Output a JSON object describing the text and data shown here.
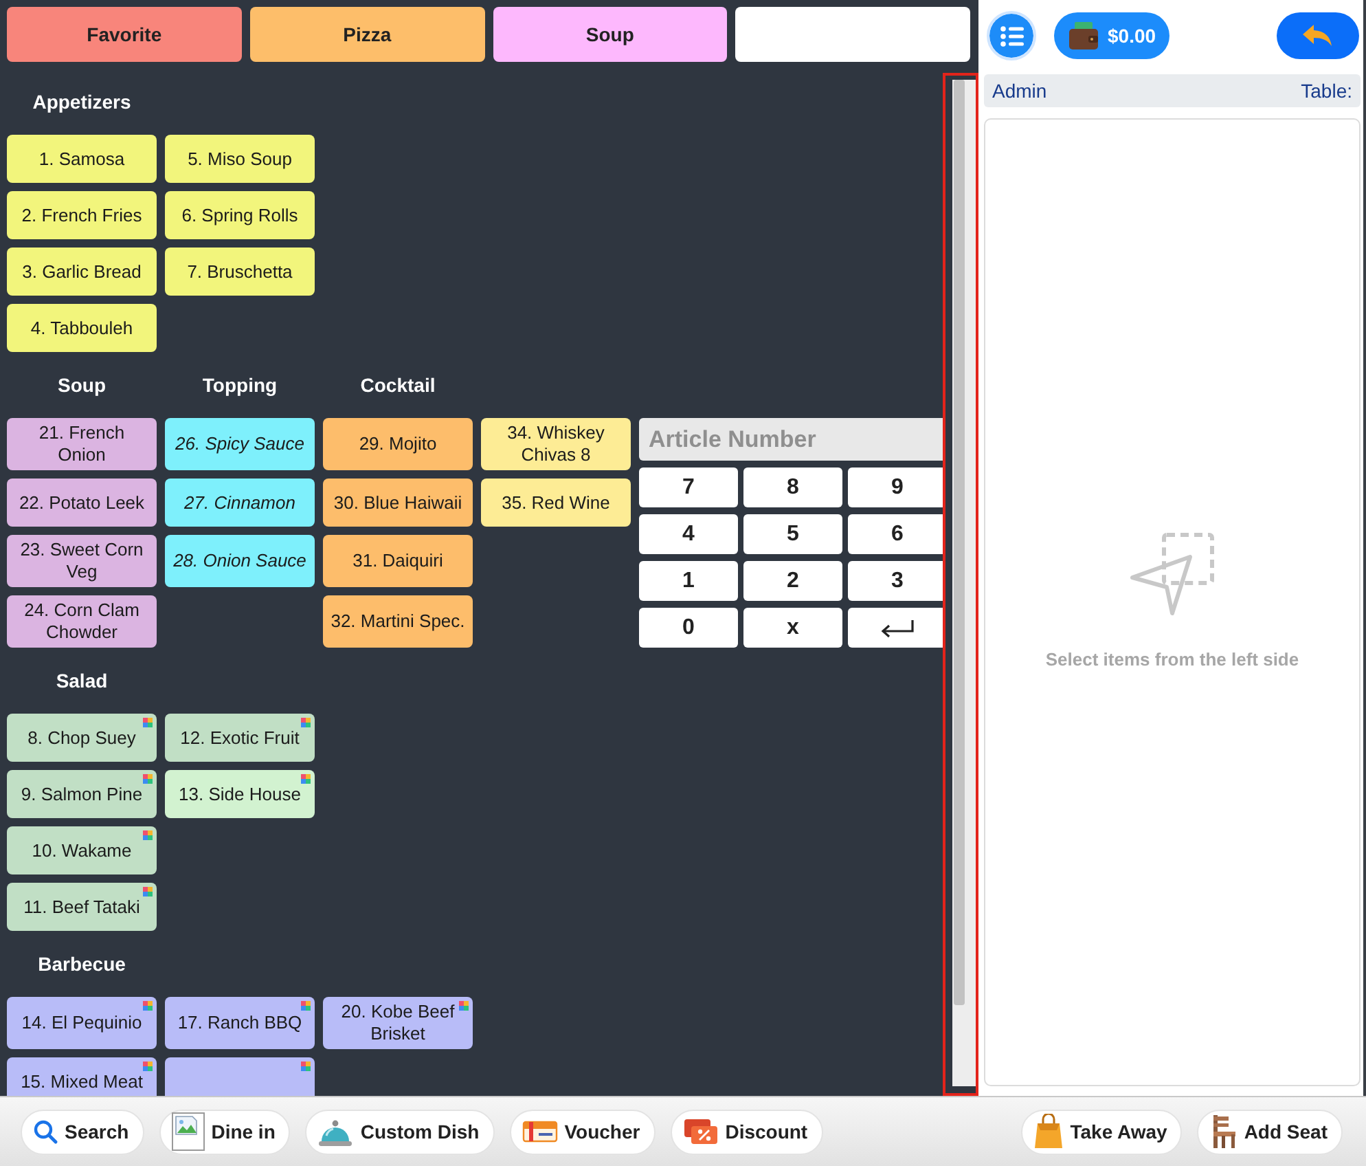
{
  "category_tabs": [
    {
      "label": "Favorite",
      "color": "#f8857b"
    },
    {
      "label": "Pizza",
      "color": "#fdbe6a"
    },
    {
      "label": "Soup",
      "color": "#fdb8fd"
    },
    {
      "color": "#ffffff"
    }
  ],
  "menu": {
    "rows": [
      {
        "sections": [
          {
            "title": "Appetizers",
            "italic": false,
            "columns": [
              [
                {
                  "label": "1. Samosa",
                  "color": "#f2f57c",
                  "badge": false
                },
                {
                  "label": "2. French Fries",
                  "color": "#f2f57c",
                  "badge": false
                },
                {
                  "label": "3. Garlic Bread",
                  "color": "#f2f57c",
                  "badge": false
                },
                {
                  "label": "4. Tabbouleh",
                  "color": "#f2f57c",
                  "badge": false
                }
              ],
              [
                {
                  "label": "5. Miso Soup",
                  "color": "#f2f57c",
                  "badge": false
                },
                {
                  "label": "6. Spring Rolls",
                  "color": "#f2f57c",
                  "badge": false
                },
                {
                  "label": "7. Bruschetta",
                  "color": "#f2f57c",
                  "badge": false
                }
              ]
            ]
          }
        ]
      },
      {
        "sections": [
          {
            "title": "Soup",
            "italic": false,
            "columns": [
              [
                {
                  "label": "21. French Onion",
                  "color": "#dbb4e1",
                  "badge": false
                },
                {
                  "label": "22. Potato Leek",
                  "color": "#dbb4e1",
                  "badge": false
                },
                {
                  "label": "23. Sweet Corn Veg",
                  "color": "#dbb4e1",
                  "badge": false
                },
                {
                  "label": "24. Corn Clam Chowder",
                  "color": "#dbb4e1",
                  "badge": false
                }
              ]
            ]
          },
          {
            "title": "Topping",
            "italic": true,
            "columns": [
              [
                {
                  "label": "26. Spicy Sauce",
                  "color": "#7ef0fc",
                  "badge": false
                },
                {
                  "label": "27. Cinnamon",
                  "color": "#7ef0fc",
                  "badge": false
                },
                {
                  "label": "28. Onion Sauce",
                  "color": "#7ef0fc",
                  "badge": false
                }
              ]
            ]
          },
          {
            "title": "Cocktail",
            "italic": false,
            "columns": [
              [
                {
                  "label": "29. Mojito",
                  "color": "#fdbd6b",
                  "badge": false
                },
                {
                  "label": "30. Blue Haiwaii",
                  "color": "#fdbd6b",
                  "badge": false
                },
                {
                  "label": "31. Daiquiri",
                  "color": "#fdbd6b",
                  "badge": false
                },
                {
                  "label": "32. Martini Spec.",
                  "color": "#fdbd6b",
                  "badge": false
                }
              ],
              [
                {
                  "label": "34. Whiskey Chivas 8",
                  "color": "#fdec95",
                  "badge": false
                },
                {
                  "label": "35. Red Wine",
                  "color": "#fdec95",
                  "badge": false
                }
              ]
            ]
          }
        ],
        "keypad": {
          "placeholder": "Article Number",
          "keys": [
            {
              "kind": "char",
              "label": "7"
            },
            {
              "kind": "char",
              "label": "8"
            },
            {
              "kind": "char",
              "label": "9"
            },
            {
              "kind": "char",
              "label": "4"
            },
            {
              "kind": "char",
              "label": "5"
            },
            {
              "kind": "char",
              "label": "6"
            },
            {
              "kind": "char",
              "label": "1"
            },
            {
              "kind": "char",
              "label": "2"
            },
            {
              "kind": "char",
              "label": "3"
            },
            {
              "kind": "char",
              "label": "0"
            },
            {
              "kind": "char",
              "label": "x"
            },
            {
              "kind": "enter"
            }
          ]
        }
      },
      {
        "sections": [
          {
            "title": "Salad",
            "italic": false,
            "columns": [
              [
                {
                  "label": "8. Chop Suey",
                  "color": "#c1dfc5",
                  "badge": true
                },
                {
                  "label": "9. Salmon Pine",
                  "color": "#c1dfc5",
                  "badge": true
                },
                {
                  "label": "10. Wakame",
                  "color": "#c1dfc5",
                  "badge": true
                },
                {
                  "label": "11. Beef Tataki",
                  "color": "#c1dfc5",
                  "badge": true
                }
              ],
              [
                {
                  "label": "12. Exotic Fruit",
                  "color": "#c1dfc5",
                  "badge": true
                },
                {
                  "label": "13. Side House",
                  "color": "#d2f2d0",
                  "badge": true
                }
              ]
            ]
          }
        ]
      },
      {
        "sections": [
          {
            "title": "Barbecue",
            "italic": false,
            "columns": [
              [
                {
                  "label": "14. El Pequinio",
                  "color": "#b8bcf8",
                  "badge": true
                },
                {
                  "label": "15. Mixed Meat",
                  "color": "#b8bcf8",
                  "badge": true
                }
              ],
              [
                {
                  "label": "17. Ranch BBQ",
                  "color": "#b8bcf8",
                  "badge": true
                },
                {
                  "color": "#b8bcf8",
                  "badge": true
                }
              ],
              [
                {
                  "label": "20. Kobe Beef Brisket",
                  "color": "#b8bcf8",
                  "badge": true
                }
              ]
            ]
          }
        ]
      }
    ]
  },
  "toolbar": {
    "balance": "$0.00"
  },
  "order_panel": {
    "user": "Admin",
    "table": "Table:",
    "empty_message": "Select items from the left side"
  },
  "bottom_bar": {
    "left": [
      {
        "kind": "search",
        "label": "Search"
      },
      {
        "kind": "image",
        "label": "Dine in"
      },
      {
        "kind": "cloche",
        "label": "Custom Dish"
      },
      {
        "kind": "voucher",
        "label": "Voucher"
      },
      {
        "kind": "discount",
        "label": "Discount"
      }
    ],
    "right": [
      {
        "kind": "bag",
        "label": "Take Away"
      },
      {
        "kind": "chair",
        "label": "Add Seat"
      }
    ]
  }
}
